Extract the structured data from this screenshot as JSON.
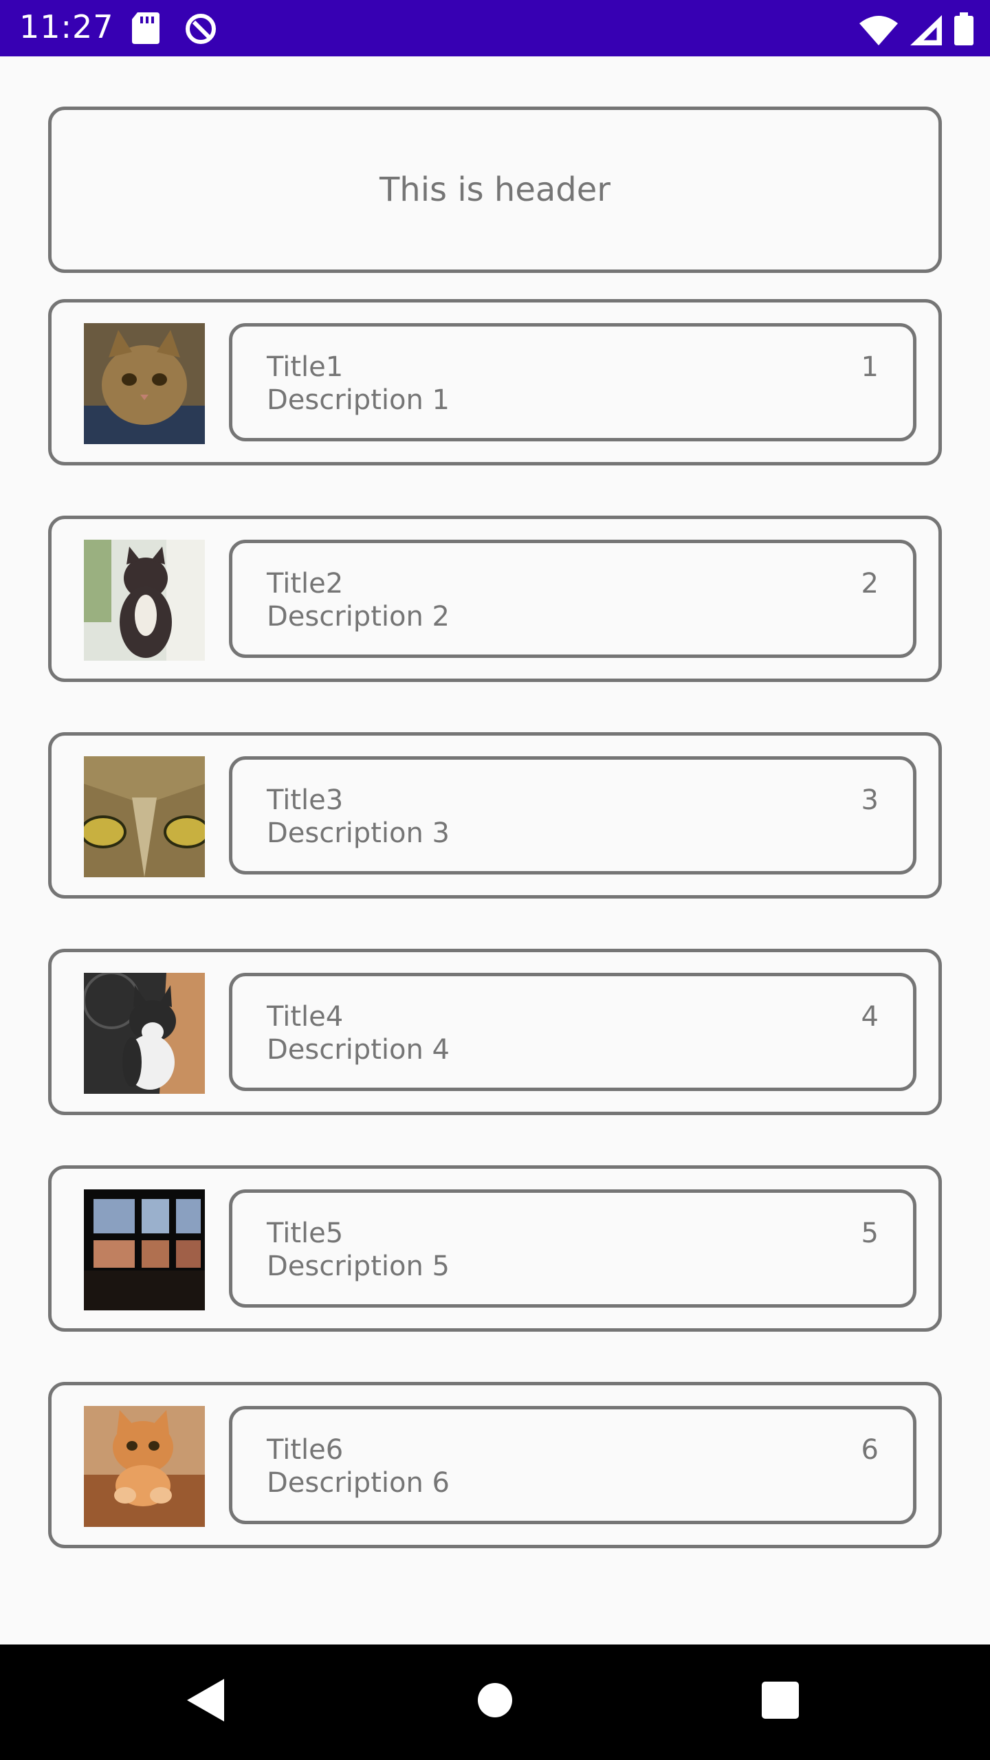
{
  "status_bar": {
    "time": "11:27",
    "left_icons": [
      "sd-card-icon",
      "data-saver-icon"
    ],
    "right_icons": [
      "wifi-icon",
      "cellular-signal-icon",
      "battery-icon"
    ]
  },
  "header": {
    "text": "This is header"
  },
  "items": [
    {
      "title": "Title1",
      "description": "Description 1",
      "number": "1",
      "image": "cat-kitten-closeup",
      "thumb_colors": [
        "#8a6a3a",
        "#4a3a28",
        "#2a3a55"
      ]
    },
    {
      "title": "Title2",
      "description": "Description 2",
      "number": "2",
      "image": "dark-kitten-window",
      "thumb_colors": [
        "#cfd8c8",
        "#3a3030",
        "#e8e8e0"
      ]
    },
    {
      "title": "Title3",
      "description": "Description 3",
      "number": "3",
      "image": "cat-eyes-closeup",
      "thumb_colors": [
        "#9a8050",
        "#6a5a38",
        "#c8b060"
      ]
    },
    {
      "title": "Title4",
      "description": "Description 4",
      "number": "4",
      "image": "black-white-kitten",
      "thumb_colors": [
        "#2a2a2a",
        "#d0a070",
        "#f0f0f0"
      ]
    },
    {
      "title": "Title5",
      "description": "Description 5",
      "number": "5",
      "image": "window-silhouette",
      "thumb_colors": [
        "#0a0a0a",
        "#8aa0c0",
        "#c08060"
      ]
    },
    {
      "title": "Title6",
      "description": "Description 6",
      "number": "6",
      "image": "orange-kitten",
      "thumb_colors": [
        "#d08040",
        "#a05020",
        "#e8c090"
      ]
    }
  ],
  "nav_bar": {
    "buttons": [
      "back-icon",
      "home-icon",
      "recents-icon"
    ]
  }
}
